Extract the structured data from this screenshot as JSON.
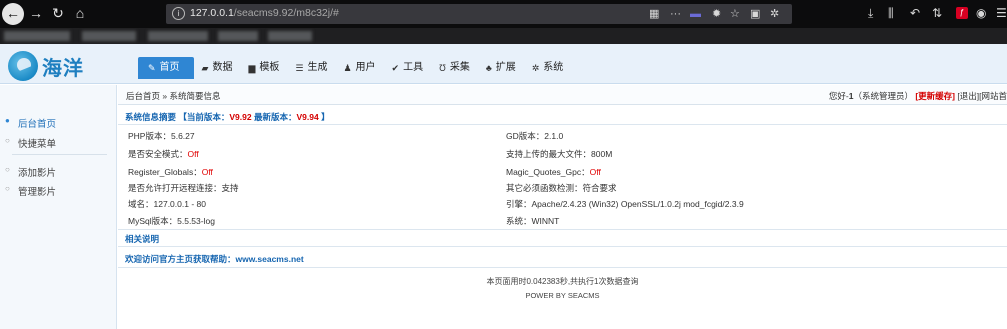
{
  "browser": {
    "url_host": "127.0.0.1",
    "url_path": "/seacms9.92/m8c32j/#"
  },
  "header": {
    "logo_text": "海洋",
    "menu": [
      {
        "label": "首页",
        "icon": "edit-icon",
        "glyph": "✎"
      },
      {
        "label": "数据",
        "icon": "data-icon",
        "glyph": "▰"
      },
      {
        "label": "模板",
        "icon": "file-icon",
        "glyph": "▆"
      },
      {
        "label": "生成",
        "icon": "list-icon",
        "glyph": "☰"
      },
      {
        "label": "用户",
        "icon": "user-icon",
        "glyph": "♟"
      },
      {
        "label": "工具",
        "icon": "wrench-icon",
        "glyph": "✔"
      },
      {
        "label": "采集",
        "icon": "magnet-icon",
        "glyph": "Ʊ"
      },
      {
        "label": "扩展",
        "icon": "sitemap-icon",
        "glyph": "♣"
      },
      {
        "label": "系统",
        "icon": "gear-icon",
        "glyph": "✲"
      }
    ]
  },
  "sidebar": {
    "items": [
      {
        "label": "后台首页"
      },
      {
        "label": "快捷菜单"
      },
      {
        "label": "添加影片"
      },
      {
        "label": "管理影片"
      }
    ]
  },
  "main": {
    "breadcrumb": "后台首页 » 系统简要信息",
    "user": {
      "greeting": "您好-",
      "name": "1",
      "role": "（系统管理员）",
      "refresh": "[更新缓存]",
      "logout": "[退出]",
      "site": "[网站首"
    },
    "summary": {
      "title": "系统信息摘要 【当前版本：",
      "current_version": "V9.92",
      "latest_label": "最新版本：",
      "latest_version": "V9.94",
      "close": " 】"
    },
    "info_left": [
      {
        "label": "PHP版本：",
        "value": "5.6.27"
      },
      {
        "label": "是否安全模式：",
        "value": "Off",
        "red": true
      },
      {
        "label": "Register_Globals：",
        "value": "Off",
        "red": true
      },
      {
        "label": "是否允许打开远程连接：",
        "value": "支持"
      },
      {
        "label": "域名：",
        "value": "127.0.0.1 - 80"
      },
      {
        "label": "MySql版本：",
        "value": "5.5.53-log"
      }
    ],
    "info_right": [
      {
        "label": "GD版本：",
        "value": "2.1.0"
      },
      {
        "label": "支持上传的最大文件：",
        "value": "800M"
      },
      {
        "label": "Magic_Quotes_Gpc：",
        "value": "Off",
        "red": true
      },
      {
        "label": "其它必须函数检测：",
        "value": "符合要求"
      },
      {
        "label": "引擎：",
        "value": "Apache/2.4.23 (Win32) OpenSSL/1.0.2j mod_fcgid/2.3.9"
      },
      {
        "label": "系统：",
        "value": "WINNT"
      }
    ],
    "related_title": "相关说明",
    "help_text": "欢迎访问官方主页获取帮助：www.seacms.net",
    "footer_time": "本页面用时0.042383秒,共执行1次数据查询",
    "footer_power": "POWER BY SEACMS"
  }
}
